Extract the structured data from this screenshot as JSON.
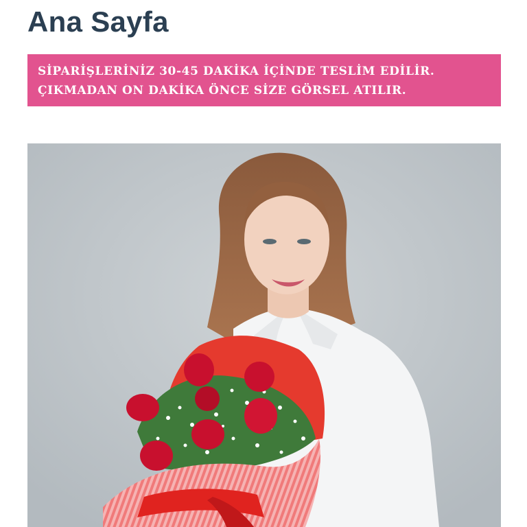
{
  "header": {
    "title": "Ana Sayfa"
  },
  "notice": {
    "line1": "SİPARİŞLERİNİZ 30-45 DAKİKA İÇİNDE TESLİM EDİLİR.",
    "line2": "ÇIKMADAN ON DAKİKA ÖNCE SİZE GÖRSEL ATILIR.",
    "background_color": "#e2538f",
    "text_color": "#ffffff"
  },
  "hero": {
    "image_subject": "woman-holding-red-rose-bouquet-photo",
    "background_color": "#bfc5c9"
  },
  "colors": {
    "title_color": "#2b3f52"
  }
}
